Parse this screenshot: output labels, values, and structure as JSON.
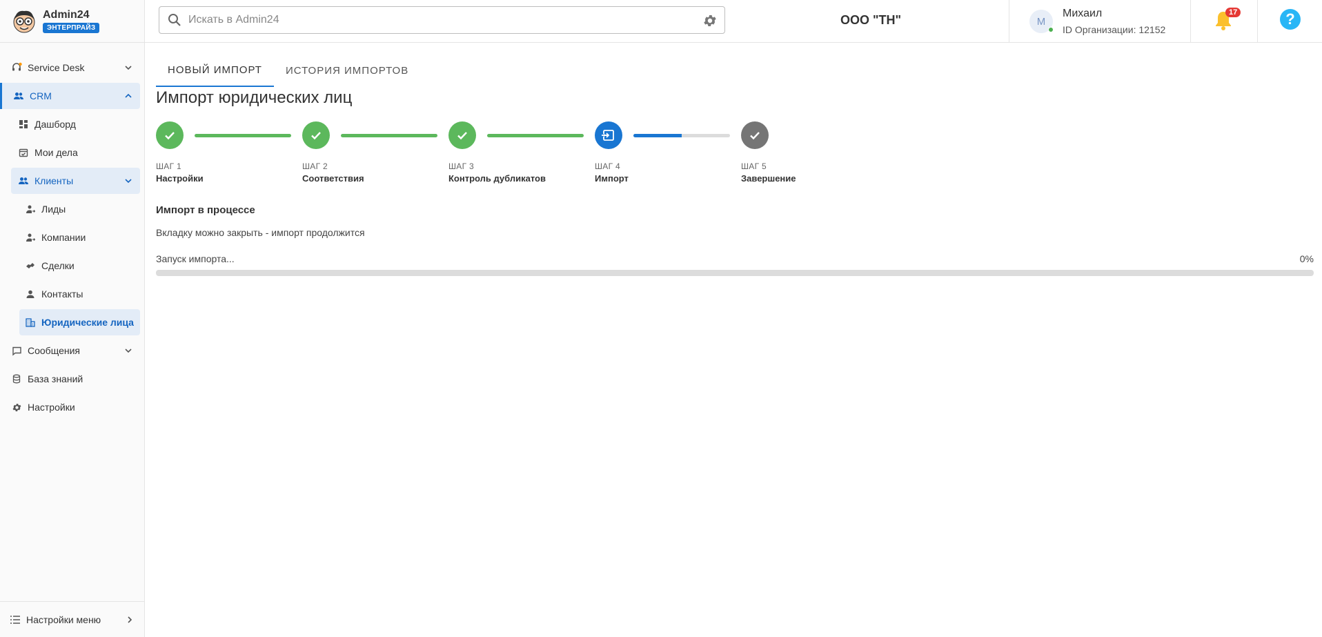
{
  "brand": {
    "name": "Admin24",
    "badge": "ЭНТЕРПРАЙЗ"
  },
  "sidebar": {
    "items": [
      {
        "label": "Service Desk"
      },
      {
        "label": "CRM"
      },
      {
        "label": "Дашборд"
      },
      {
        "label": "Мои дела"
      },
      {
        "label": "Клиенты"
      },
      {
        "label": "Лиды"
      },
      {
        "label": "Компании"
      },
      {
        "label": "Сделки"
      },
      {
        "label": "Контакты"
      },
      {
        "label": "Юридические лица"
      },
      {
        "label": "Сообщения"
      },
      {
        "label": "База знаний"
      },
      {
        "label": "Настройки"
      }
    ],
    "footer_label": "Настройки меню"
  },
  "topbar": {
    "search_placeholder": "Искать в Admin24",
    "org_name": "ООО \"ТН\"",
    "user": {
      "initial": "M",
      "name": "Михаил",
      "org_id": "ID Организации: 12152"
    },
    "notifications_count": "17",
    "help_label": "?"
  },
  "tabs": [
    {
      "label": "Новый импорт"
    },
    {
      "label": "История импортов"
    }
  ],
  "page_title": "Импорт юридических лиц",
  "steps": [
    {
      "num": "ШАГ 1",
      "label": "Настройки",
      "state": "done",
      "line_fill": 1.0
    },
    {
      "num": "ШАГ 2",
      "label": "Соответствия",
      "state": "done",
      "line_fill": 1.0
    },
    {
      "num": "ШАГ 3",
      "label": "Контроль дубликатов",
      "state": "done",
      "line_fill": 1.0
    },
    {
      "num": "ШАГ 4",
      "label": "Импорт",
      "state": "current",
      "line_fill": 0.5
    },
    {
      "num": "ШАГ 5",
      "label": "Завершение",
      "state": "pending"
    }
  ],
  "status": {
    "title": "Импорт в процессе",
    "description": "Вкладку можно закрыть - импорт продолжится",
    "progress_label": "Запуск импорта...",
    "progress_percent_text": "0%",
    "progress_value": 0
  },
  "colors": {
    "accent": "#1976d2",
    "success": "#5cb85c",
    "pending": "#757575",
    "badge_alert": "#e53935"
  }
}
